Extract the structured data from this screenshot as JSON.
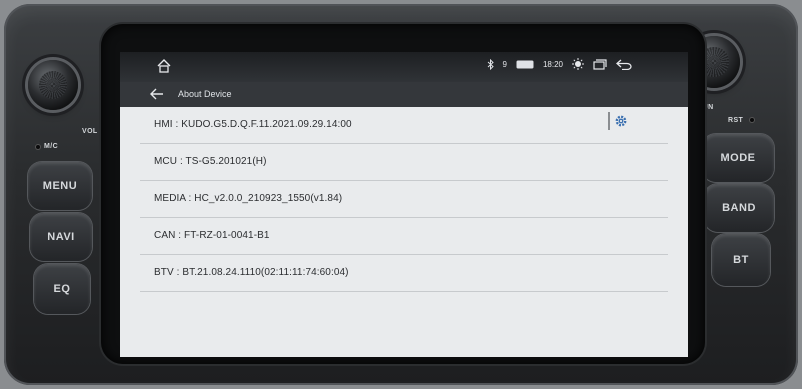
{
  "hardware": {
    "vol_label": "VOL",
    "mic_label": "M/C",
    "tun_label": "TUN",
    "rst_label": "RST",
    "buttons_left": [
      "MENU",
      "NAVI",
      "EQ"
    ],
    "buttons_right": [
      "MODE",
      "BAND",
      "BT"
    ]
  },
  "statusbar": {
    "time": "18:20",
    "signal": "9"
  },
  "appbar": {
    "title": "About Device"
  },
  "info_rows": [
    {
      "text": "HMI : KUDO.G5.D.Q.F.11.2021.09.29.14:00"
    },
    {
      "text": "MCU : TS-G5.201021(H)"
    },
    {
      "text": "MEDIA : HC_v2.0.0_210923_1550(v1.84)"
    },
    {
      "text": "CAN : FT-RZ-01-0041-B1"
    },
    {
      "text": "BTV : BT.21.08.24.1110(02:11:11:74:60:04)"
    }
  ],
  "icons": [
    "home-icon",
    "bluetooth-icon",
    "wifi-icon",
    "brightness-icon",
    "window-icon",
    "return-icon",
    "back-arrow-icon",
    "settings-gear-icon"
  ]
}
